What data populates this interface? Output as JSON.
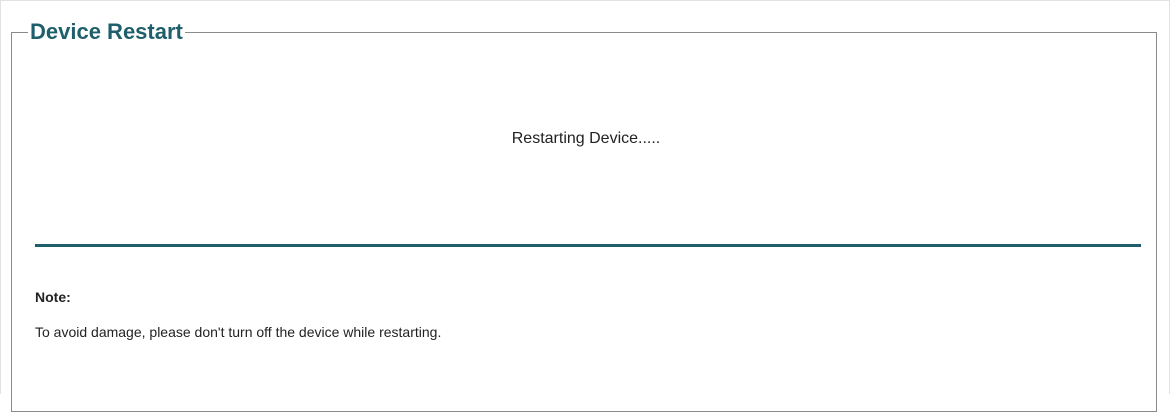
{
  "panel": {
    "title": "Device Restart",
    "status_text": "Restarting Device.....",
    "note": {
      "label": "Note:",
      "text": "To avoid damage, please don't turn off the device while restarting."
    }
  },
  "colors": {
    "title": "#1f5f6b",
    "divider": "#1f5f6b",
    "border": "#8a8a8a"
  }
}
